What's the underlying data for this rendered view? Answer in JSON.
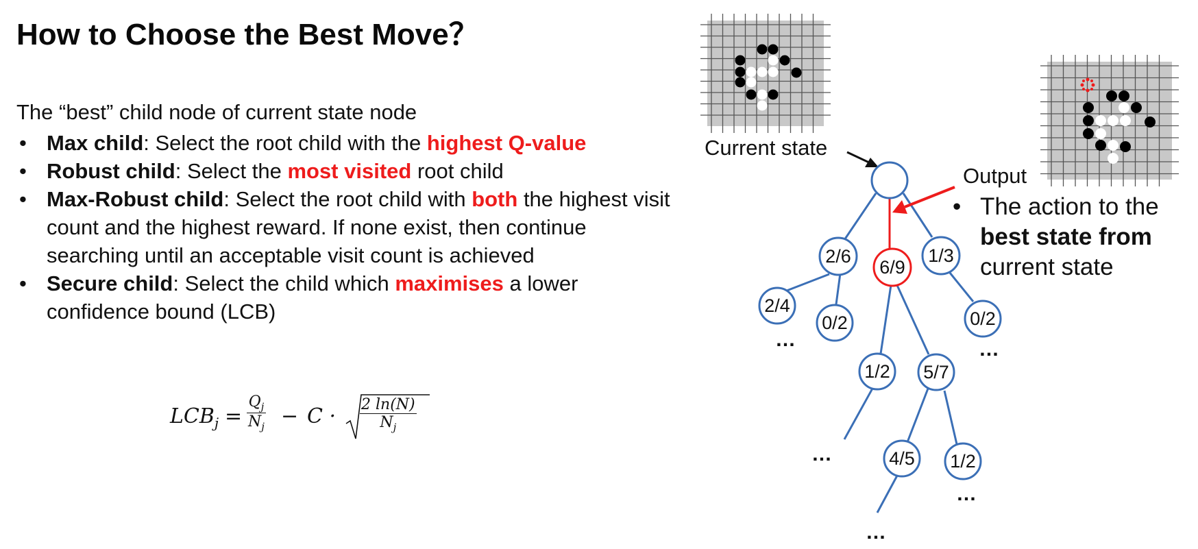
{
  "title": "How to Choose the Best Move？",
  "intro": "The “best” child node of current state node",
  "bullets": [
    {
      "strong": "Max child",
      "t1": ": Select the root child with the ",
      "red": "highest Q-value",
      "t2": ""
    },
    {
      "strong": "Robust child",
      "t1": ": Select the ",
      "red": "most visited",
      "t2": " root child"
    },
    {
      "strong": "Max-Robust child",
      "t1": ": Select the root child with ",
      "red": "both",
      "t2": " the highest visit count and the highest reward. If none exist, then continue searching until an acceptable visit count is achieved"
    },
    {
      "strong": "Secure child",
      "t1": ": Select the child which ",
      "red": "maximises",
      "t2": " a lower confidence bound (LCB)"
    }
  ],
  "formula": {
    "lhs": "LCB",
    "lhs_sub": "j",
    "equals": "=",
    "q": "Q",
    "q_sub": "j",
    "n": "N",
    "n_sub": "j",
    "minus": "−",
    "c_term": "C ·",
    "sqrt_num": "2 ln(N)",
    "sqrt_den": "N",
    "sqrt_den_sub": "j"
  },
  "diagram": {
    "current_state_label": "Current state",
    "output_label": "Output",
    "output_desc": {
      "t1": "The action to the ",
      "strong": "best state from",
      "t2": " current state"
    },
    "nodes": [
      "",
      "2/6",
      "6/9",
      "1/3",
      "2/4",
      "0/2",
      "0/2",
      "1/2",
      "5/7",
      "4/5",
      "1/2"
    ],
    "ellipsis": "…",
    "colors": {
      "tree": "#3b6fb6",
      "highlight": "#ee1c1c",
      "board": "#c8c8c8",
      "grid": "#555555"
    }
  }
}
